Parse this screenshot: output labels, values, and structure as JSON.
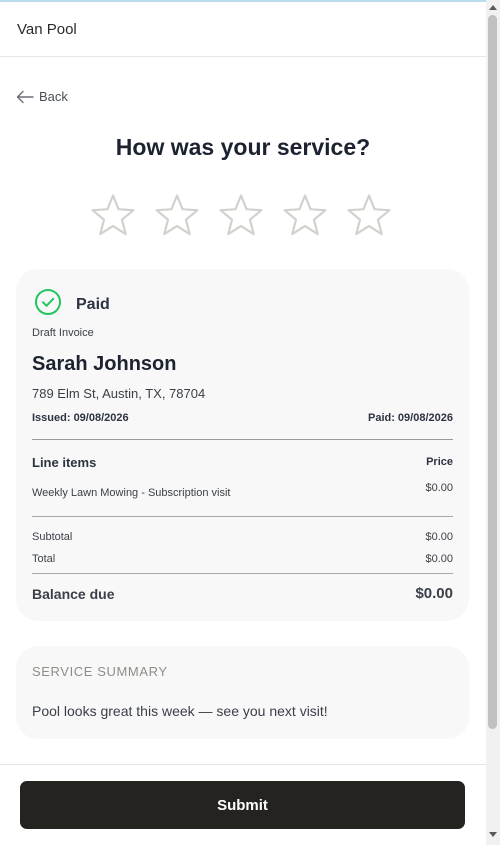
{
  "app": {
    "title": "Van Pool"
  },
  "nav": {
    "back_label": "Back",
    "back_icon": "arrow-left-icon"
  },
  "rating": {
    "question": "How was your service?",
    "star_count": 5,
    "selected": 0,
    "star_color": "#d3d1cc"
  },
  "invoice": {
    "status_label": "Paid",
    "status_icon": "check-circle-icon",
    "status_color": "#22c55e",
    "type_label": "Draft Invoice",
    "customer_name": "Sarah Johnson",
    "address": "789 Elm St, Austin, TX, 78704",
    "issued_label": "Issued: 09/08/2026",
    "paid_label": "Paid: 09/08/2026",
    "line_items_header": "Line items",
    "price_header": "Price",
    "line_items": [
      {
        "description": "Weekly Lawn Mowing - Subscription visit",
        "price": "$0.00"
      }
    ],
    "subtotal_label": "Subtotal",
    "subtotal_value": "$0.00",
    "total_label": "Total",
    "total_value": "$0.00",
    "balance_label": "Balance due",
    "balance_value": "$0.00"
  },
  "summary": {
    "title": "SERVICE SUMMARY",
    "text": "Pool looks great this week — see you next visit!"
  },
  "footer": {
    "submit_label": "Submit",
    "button_color": "#252320"
  }
}
